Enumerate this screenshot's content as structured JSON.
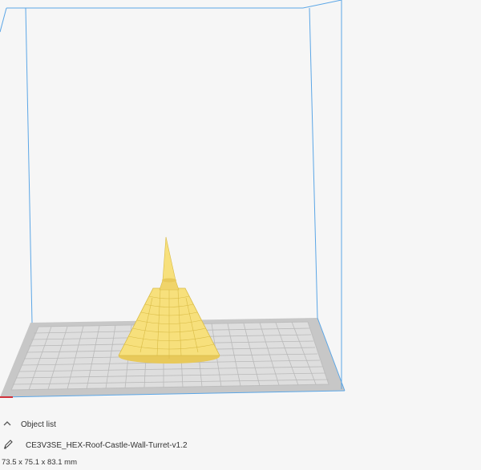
{
  "object_panel": {
    "toggle_label": "Object list",
    "toggle_icon": "chevron-up-icon",
    "object_name": "CE3V3SE_HEX-Roof-Castle-Wall-Turret-v1.2",
    "edit_icon": "pencil-icon",
    "dimensions": "73.5 x 75.1 x 83.1 mm"
  },
  "colors": {
    "background": "#f6f6f6",
    "build_volume_edge": "#5ba6e6",
    "bed_grid": "#cfcfcf",
    "model": "#f7e07c"
  }
}
